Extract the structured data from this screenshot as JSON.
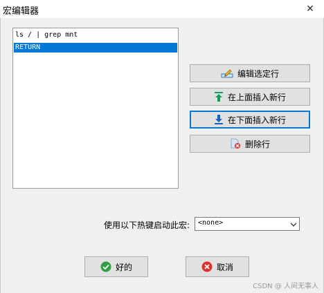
{
  "window": {
    "title": "宏编辑器",
    "close_glyph": "✕"
  },
  "macro_list": {
    "items": [
      {
        "text": "ls / | grep mnt",
        "selected": false
      },
      {
        "text": "RETURN",
        "selected": true
      }
    ]
  },
  "actions": {
    "edit_label": "编辑选定行",
    "insert_above_label": "在上面插入新行",
    "insert_below_label": "在下面插入新行",
    "delete_label": "删除行"
  },
  "hotkey": {
    "label": "使用以下热键启动此宏:",
    "value": "<none>"
  },
  "footer": {
    "ok_label": "好的",
    "cancel_label": "取消"
  },
  "watermark": "CSDN @ 人间无事人",
  "colors": {
    "selection": "#0078d7",
    "ok_green": "#2ea043",
    "cancel_red": "#e03131",
    "arrow_green": "#0f9d58",
    "arrow_blue": "#1565c0"
  }
}
